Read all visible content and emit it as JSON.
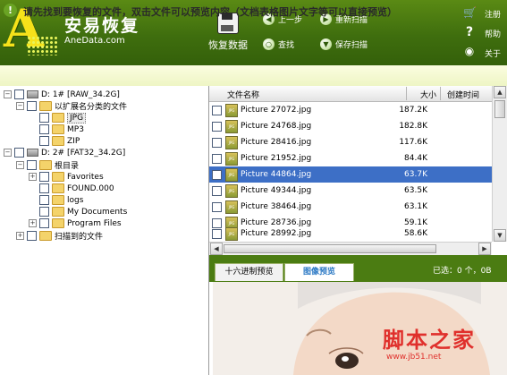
{
  "app": {
    "name_cn": "安易恢复",
    "name_en": "AneData.com",
    "logo_letter": "A"
  },
  "toolbar": {
    "recover": "恢复数据",
    "prev": "上一步",
    "rescan": "重新扫描",
    "find": "查找",
    "save_scan": "保存扫描"
  },
  "sidebar_links": {
    "register": "注册",
    "help": "帮助",
    "about": "关于"
  },
  "notice": "请先找到要恢复的文件，双击文件可以预览内容（文档表格图片文字等可以直接预览）",
  "tree": {
    "drive1": "D:  1# [RAW_34.2G]",
    "by_ext": "以扩展名分类的文件",
    "jpg": "JPG",
    "mp3": "MP3",
    "zip": "ZIP",
    "drive2": "D:  2# [FAT32_34.2G]",
    "root": "根目录",
    "favorites": "Favorites",
    "found": "FOUND.000",
    "logs": "logs",
    "mydocs": "My Documents",
    "progfiles": "Program Files",
    "scanned": "扫描到的文件"
  },
  "list": {
    "col_name": "文件名称",
    "col_size": "大小",
    "col_created": "创建时间",
    "rows": [
      {
        "name": "Picture 27072.jpg",
        "size": "187.2K"
      },
      {
        "name": "Picture 24768.jpg",
        "size": "182.8K"
      },
      {
        "name": "Picture 28416.jpg",
        "size": "117.6K"
      },
      {
        "name": "Picture 21952.jpg",
        "size": "84.4K"
      },
      {
        "name": "Picture 44864.jpg",
        "size": "63.7K"
      },
      {
        "name": "Picture 49344.jpg",
        "size": "63.5K"
      },
      {
        "name": "Picture 38464.jpg",
        "size": "63.1K"
      },
      {
        "name": "Picture 28736.jpg",
        "size": "59.1K"
      },
      {
        "name": "Picture 28992.jpg",
        "size": "58.6K"
      }
    ]
  },
  "preview": {
    "tab_hex": "十六进制预览",
    "tab_image": "图像预览",
    "selection": "已选：0 个，0B"
  },
  "watermark": {
    "cn": "脚本之家",
    "url": "www.jb51.net"
  },
  "colors": {
    "header_green": "#4a7a12",
    "selection_blue": "#3d6fc6",
    "logo_yellow": "#f6e21a"
  }
}
